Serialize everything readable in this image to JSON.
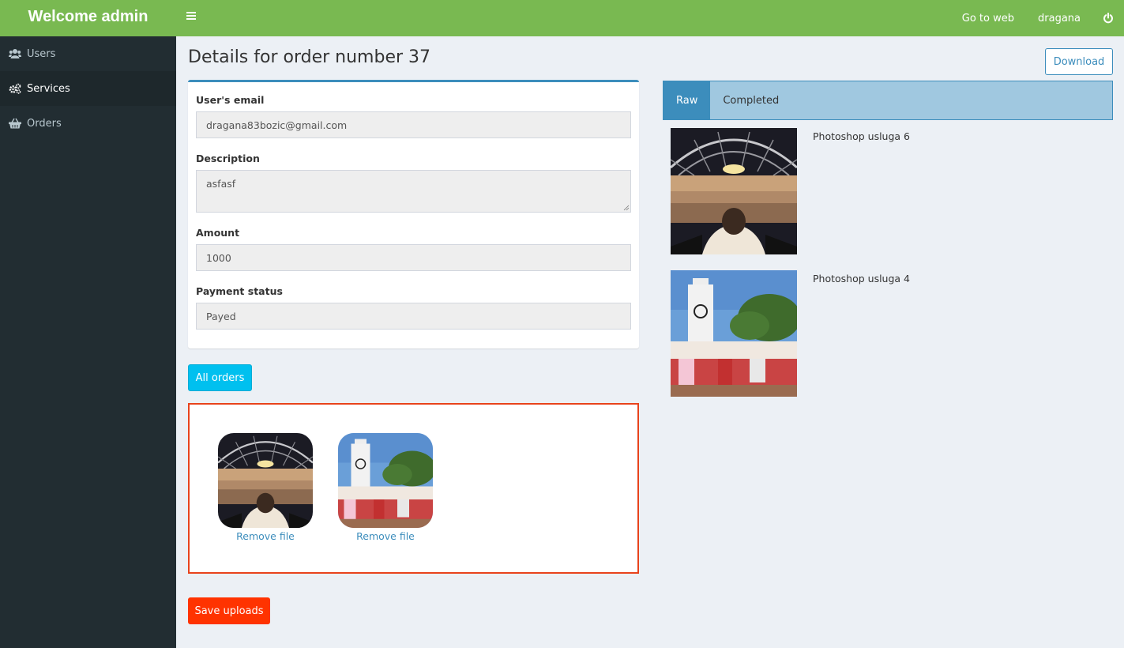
{
  "header": {
    "logo": "Welcome admin",
    "nav": {
      "go_to_web": "Go to web",
      "user": "dragana"
    },
    "brand_color": "#79b951",
    "icons": {
      "menu": "hamburger-icon",
      "power": "power-icon"
    }
  },
  "sidebar": {
    "items": [
      {
        "label": "Users",
        "icon": "users-icon"
      },
      {
        "label": "Services",
        "icon": "cogs-icon",
        "active": true
      },
      {
        "label": "Orders",
        "icon": "basket-icon"
      }
    ]
  },
  "page": {
    "title": "Details for order number 37",
    "download_label": "Download"
  },
  "form": {
    "email_label": "User's email",
    "email_value": "dragana83bozic@gmail.com",
    "description_label": "Description",
    "description_value": "asfasf",
    "amount_label": "Amount",
    "amount_value": "1000",
    "payment_label": "Payment status",
    "payment_value": "Payed"
  },
  "buttons": {
    "all_orders": "All orders",
    "save_uploads": "Save uploads"
  },
  "dropzone": {
    "files": [
      {
        "remove_label": "Remove file",
        "image": "concert-photo"
      },
      {
        "remove_label": "Remove file",
        "image": "clock-tower-photo"
      }
    ],
    "border_color": "#e8431c"
  },
  "tabs": [
    {
      "label": "Raw",
      "active": true
    },
    {
      "label": "Completed"
    }
  ],
  "media": [
    {
      "title": "Photoshop usluga 6",
      "image": "concert-photo"
    },
    {
      "title": "Photoshop usluga 4",
      "image": "clock-tower-photo"
    }
  ]
}
